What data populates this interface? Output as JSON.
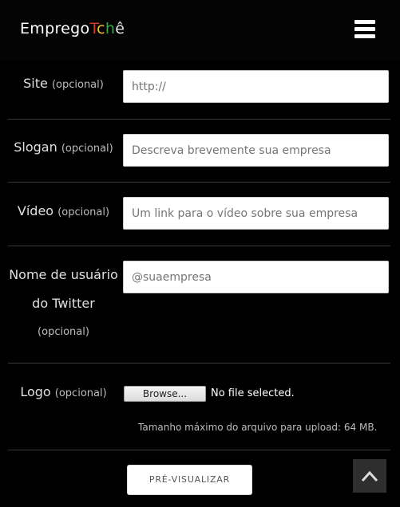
{
  "header": {
    "logo_part1": "Emprego",
    "logo_part2": [
      "T",
      "c",
      "h",
      "ê"
    ],
    "logo_colors": [
      "#d83a2a",
      "#f0c419",
      "#3aa84a",
      "#e6e6e6"
    ]
  },
  "form": {
    "site": {
      "label": "Site",
      "optional": "(opcional)",
      "placeholder": "http://"
    },
    "slogan": {
      "label": "Slogan",
      "optional": "(opcional)",
      "placeholder": "Descreva brevemente sua empresa"
    },
    "video": {
      "label": "Vídeo",
      "optional": "(opcional)",
      "placeholder": "Um link para o vídeo sobre sua empresa"
    },
    "twitter": {
      "label_line1": "Nome de usuário",
      "label_line2": "do Twitter",
      "optional": "(opcional)",
      "placeholder": "@suaempresa"
    },
    "logo": {
      "label": "Logo",
      "optional": "(opcional)",
      "browse": "Browse...",
      "file_status": "No file selected.",
      "hint": "Tamanho máximo do arquivo para upload: 64 MB."
    }
  },
  "buttons": {
    "preview": "PRÉ-VISUALIZAR"
  },
  "icons": {
    "menu": "hamburger-icon",
    "back_to_top": "chevron-up-icon"
  }
}
